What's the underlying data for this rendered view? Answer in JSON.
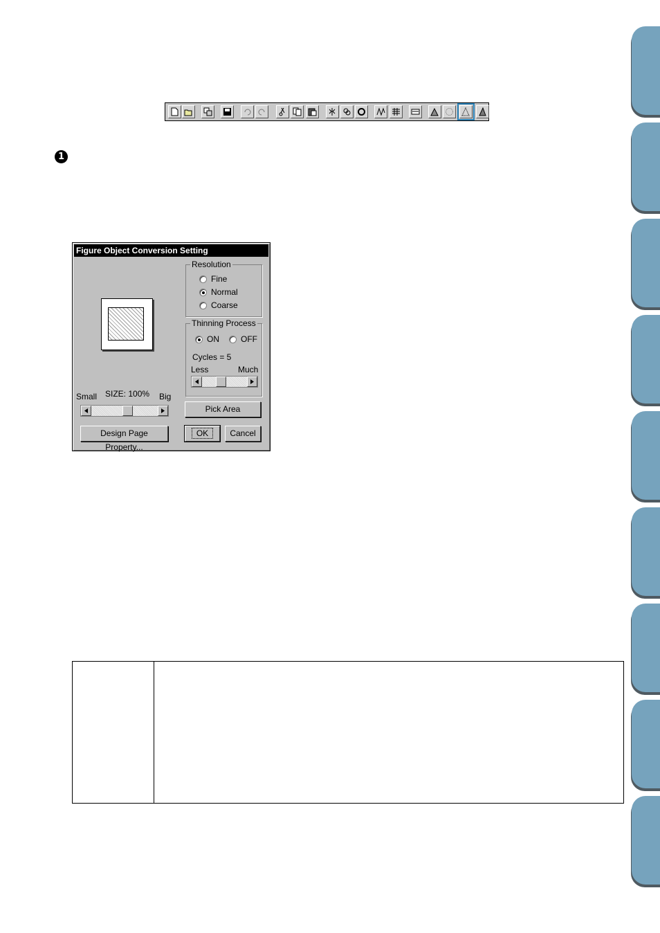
{
  "toolbar": {
    "buttons": [
      {
        "name": "new-icon"
      },
      {
        "name": "open-icon"
      },
      {
        "name": "import-icon"
      },
      {
        "name": "save-icon"
      },
      {
        "name": "undo-icon"
      },
      {
        "name": "redo-icon"
      },
      {
        "name": "cut-icon"
      },
      {
        "name": "copy-icon"
      },
      {
        "name": "paste-icon"
      },
      {
        "name": "mirror-icon"
      },
      {
        "name": "duplicate-icon"
      },
      {
        "name": "rotate-icon"
      },
      {
        "name": "stitch-icon"
      },
      {
        "name": "pattern-icon"
      },
      {
        "name": "sewing-attribute-icon"
      },
      {
        "name": "image-to-stitch-icon"
      },
      {
        "name": "photo-stitch-icon"
      },
      {
        "name": "figure-object-conversion-icon",
        "highlighted": true
      },
      {
        "name": "stitch-simulator-icon"
      }
    ],
    "highlight_color": "#2a82b8"
  },
  "step_marker": "1",
  "dialog": {
    "title": "Figure Object Conversion Setting",
    "resolution": {
      "label": "Resolution",
      "options": [
        "Fine",
        "Normal",
        "Coarse"
      ],
      "selected": "Normal"
    },
    "thinning": {
      "label": "Thinning Process",
      "on_label": "ON",
      "off_label": "OFF",
      "selected": "ON",
      "cycles_text": "Cycles = 5",
      "less_label": "Less",
      "much_label": "Much",
      "slider_level": 0.4
    },
    "size": {
      "small_label": "Small",
      "size_text": "SIZE: 100%",
      "big_label": "Big",
      "slider_level": 0.55
    },
    "buttons": {
      "pick_area": "Pick Area",
      "design_page_property": "Design Page Property...",
      "ok": "OK",
      "cancel": "Cancel"
    }
  },
  "colors": {
    "tab_color": "#76a3bd",
    "dialog_bg": "#c0c0c0",
    "titlebar_bg": "#000000"
  }
}
